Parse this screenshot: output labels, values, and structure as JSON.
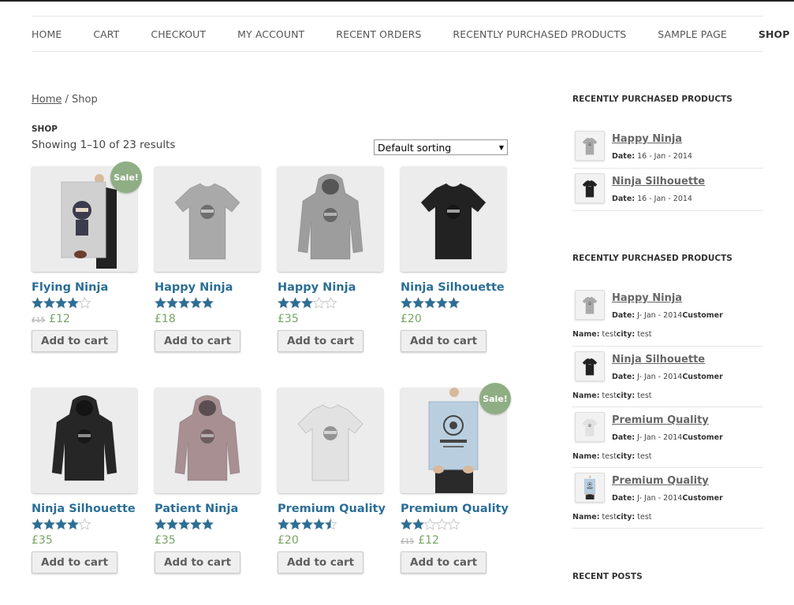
{
  "nav": {
    "items": [
      {
        "label": "HOME"
      },
      {
        "label": "CART"
      },
      {
        "label": "CHECKOUT"
      },
      {
        "label": "MY ACCOUNT"
      },
      {
        "label": "RECENT ORDERS"
      },
      {
        "label": "RECENTLY PURCHASED PRODUCTS"
      },
      {
        "label": "SAMPLE PAGE"
      },
      {
        "label": "SHOP",
        "active": true
      }
    ]
  },
  "breadcrumb": {
    "home": "Home",
    "separator": " / ",
    "current": "Shop"
  },
  "shop": {
    "heading": "SHOP",
    "result_count": "Showing 1–10 of 23 results",
    "sort_selected": "Default sorting"
  },
  "colors": {
    "accent_link": "#2b6e96",
    "price": "#77a464",
    "sale_badge": "#8fae84"
  },
  "products": [
    {
      "title": "Flying Ninja",
      "rating": 4,
      "old_price": "£15",
      "price": "£12",
      "sale": "Sale!",
      "button": "Add to cart",
      "image": "poster-ninja-icon"
    },
    {
      "title": "Happy Ninja",
      "rating": 5,
      "old_price": "",
      "price": "£18",
      "sale": "",
      "button": "Add to cart",
      "image": "grey-tshirt-icon"
    },
    {
      "title": "Happy Ninja",
      "rating": 3,
      "old_price": "",
      "price": "£35",
      "sale": "",
      "button": "Add to cart",
      "image": "grey-hoodie-icon"
    },
    {
      "title": "Ninja Silhouette",
      "rating": 5,
      "old_price": "",
      "price": "£20",
      "sale": "",
      "button": "Add to cart",
      "image": "black-tshirt-icon"
    },
    {
      "title": "Ninja Silhouette",
      "rating": 4,
      "old_price": "",
      "price": "£35",
      "sale": "",
      "button": "Add to cart",
      "image": "black-hoodie-icon"
    },
    {
      "title": "Patient Ninja",
      "rating": 5,
      "old_price": "",
      "price": "£35",
      "sale": "",
      "button": "Add to cart",
      "image": "pink-hoodie-icon"
    },
    {
      "title": "Premium Quality",
      "rating": 4.5,
      "old_price": "",
      "price": "£20",
      "sale": "",
      "button": "Add to cart",
      "image": "white-tshirt-icon"
    },
    {
      "title": "Premium Quality",
      "rating": 2,
      "old_price": "£15",
      "price": "£12",
      "sale": "Sale!",
      "button": "Add to cart",
      "image": "poster-woothemes-icon"
    }
  ],
  "sidebar": {
    "widget1": {
      "title": "RECENTLY PURCHASED PRODUCTS",
      "items": [
        {
          "name": "Happy Ninja",
          "date_label": "Date:",
          "date": "16 - Jan - 2014",
          "image": "grey-tshirt-icon"
        },
        {
          "name": "Ninja Silhouette",
          "date_label": "Date:",
          "date": "16 - Jan - 2014",
          "image": "black-tshirt-icon"
        }
      ]
    },
    "widget2": {
      "title": "RECENTLY PURCHASED PRODUCTS",
      "items": [
        {
          "name": "Happy Ninja",
          "date_label": "Date:",
          "date": "J- Jan - 2014",
          "customer_label": "Customer",
          "name_label": "Name:",
          "name_value": "test",
          "city_label": "city:",
          "city_value": "test",
          "image": "grey-tshirt-icon"
        },
        {
          "name": "Ninja Silhouette",
          "date_label": "Date:",
          "date": "J- Jan - 2014",
          "customer_label": "Customer",
          "name_label": "Name:",
          "name_value": "test",
          "city_label": "city:",
          "city_value": "test",
          "image": "black-tshirt-icon"
        },
        {
          "name": "Premium Quality",
          "date_label": "Date:",
          "date": "J- Jan - 2014",
          "customer_label": "Customer",
          "name_label": "Name:",
          "name_value": "test",
          "city_label": "city:",
          "city_value": "test",
          "image": "white-tshirt-icon"
        },
        {
          "name": "Premium Quality",
          "date_label": "Date:",
          "date": "J- Jan - 2014",
          "customer_label": "Customer",
          "name_label": "Name:",
          "name_value": "test",
          "city_label": "city:",
          "city_value": "test",
          "image": "poster-woothemes-icon"
        }
      ]
    },
    "widget3": {
      "title": "RECENT POSTS"
    }
  }
}
